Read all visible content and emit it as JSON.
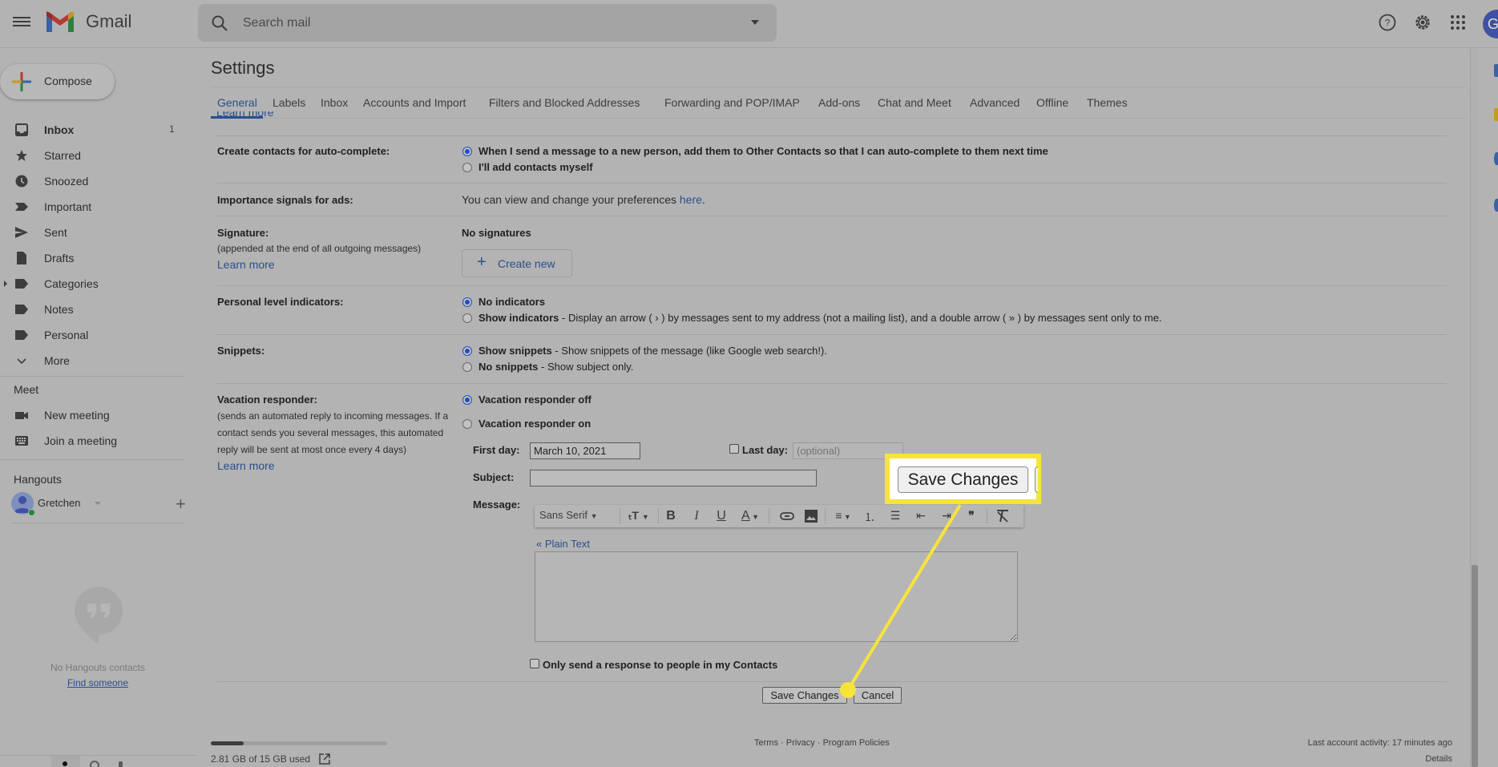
{
  "app": {
    "name": "Gmail",
    "account_initial": "G"
  },
  "search": {
    "placeholder": "Search mail"
  },
  "header_icons": [
    "help-icon",
    "settings-icon",
    "apps-icon"
  ],
  "sidebar": {
    "compose_label": "Compose",
    "items": [
      {
        "label": "Inbox",
        "count": "1",
        "icon": "inbox-icon",
        "bold": true
      },
      {
        "label": "Starred",
        "count": "",
        "icon": "star-icon"
      },
      {
        "label": "Snoozed",
        "count": "",
        "icon": "clock-icon"
      },
      {
        "label": "Important",
        "count": "",
        "icon": "important-icon"
      },
      {
        "label": "Sent",
        "count": "",
        "icon": "send-icon"
      },
      {
        "label": "Drafts",
        "count": "",
        "icon": "draft-icon"
      },
      {
        "label": "Categories",
        "count": "",
        "icon": "label-icon"
      },
      {
        "label": "Notes",
        "count": "",
        "icon": "label-icon"
      },
      {
        "label": "Personal",
        "count": "",
        "icon": "label-icon"
      },
      {
        "label": "More",
        "count": "",
        "icon": "chevron-down-icon"
      }
    ],
    "meet": {
      "heading": "Meet",
      "new_meeting": "New meeting",
      "join_meeting": "Join a meeting"
    },
    "hangouts": {
      "heading": "Hangouts",
      "user_name": "Gretchen",
      "no_contacts": "No Hangouts contacts",
      "find_someone": "Find someone"
    }
  },
  "settings": {
    "title": "Settings",
    "tabs": [
      {
        "label": "General",
        "active": true
      },
      {
        "label": "Labels"
      },
      {
        "label": "Inbox"
      },
      {
        "label": "Accounts and Import"
      },
      {
        "label": "Filters and Blocked Addresses"
      },
      {
        "label": "Forwarding and POP/IMAP"
      },
      {
        "label": "Add-ons"
      },
      {
        "label": "Chat and Meet"
      },
      {
        "label": "Advanced"
      },
      {
        "label": "Offline"
      },
      {
        "label": "Themes"
      }
    ],
    "scrolled_link": "Learn more",
    "auto_complete": {
      "label": "Create contacts for auto-complete:",
      "option1": "When I send a message to a new person, add them to Other Contacts so that I can auto-complete to them next time",
      "option2": "I'll add contacts myself",
      "selected": 1
    },
    "ads": {
      "label": "Importance signals for ads:",
      "text": "You can view and change your preferences ",
      "link": "here",
      "suffix": "."
    },
    "signature": {
      "label": "Signature:",
      "sub": "(appended at the end of all outgoing messages)",
      "learn_more": "Learn more",
      "status": "No signatures",
      "create_new": "Create new"
    },
    "personal_indicators": {
      "label": "Personal level indicators:",
      "option1": "No indicators",
      "option2_bold": "Show indicators",
      "option2_desc": " - Display an arrow ( › ) by messages sent to my address (not a mailing list), and a double arrow ( » ) by messages sent only to me.",
      "selected": 1
    },
    "snippets": {
      "label": "Snippets:",
      "option1_bold": "Show snippets",
      "option1_desc": " - Show snippets of the message (like Google web search!).",
      "option2_bold": "No snippets",
      "option2_desc": " - Show subject only.",
      "selected": 1
    },
    "vacation": {
      "label": "Vacation responder:",
      "sub_line1": "(sends an automated reply to incoming messages. If a",
      "sub_line2": "contact sends you several messages, this automated",
      "sub_line3": "reply will be sent at most once every 4 days)",
      "learn_more": "Learn more",
      "option_off": "Vacation responder off",
      "option_on": "Vacation responder on",
      "selected": "off",
      "first_day_label": "First day:",
      "first_day_value": "March 10, 2021",
      "last_day_label": "Last day:",
      "last_day_placeholder": "(optional)",
      "last_day_checked": false,
      "subject_label": "Subject:",
      "subject_value": "",
      "message_label": "Message:",
      "font_name": "Sans Serif",
      "plain_text_link": "« Plain Text",
      "contacts_only_label": "Only send a response to people in my Contacts",
      "contacts_only_checked": false
    },
    "toolbar_icons": [
      "font-size-icon",
      "bold-icon",
      "italic-icon",
      "underline-icon",
      "text-color-icon",
      "link-icon",
      "image-icon",
      "align-icon",
      "numbered-list-icon",
      "bulleted-list-icon",
      "indent-less-icon",
      "indent-more-icon",
      "quote-icon",
      "remove-formatting-icon"
    ],
    "toolbar_glyphs": {
      "bold": "B",
      "italic": "I",
      "underline": "U",
      "text_color": "A",
      "quote": "❞"
    },
    "buttons": {
      "save": "Save Changes",
      "cancel": "Cancel"
    },
    "callout": {
      "label": "Save Changes",
      "highlight_color": "#f7e43a"
    }
  },
  "footer": {
    "storage_text": "2.81 GB of 15 GB used",
    "storage_used_fraction": 0.187,
    "links": [
      "Terms",
      "Privacy",
      "Program Policies"
    ],
    "last_activity": "Last account activity: 17 minutes ago",
    "details": "Details"
  },
  "colors": {
    "accent": "#2a4f8c",
    "highlight": "#f7e43a",
    "overlay_bg": "#b3b3b3"
  }
}
